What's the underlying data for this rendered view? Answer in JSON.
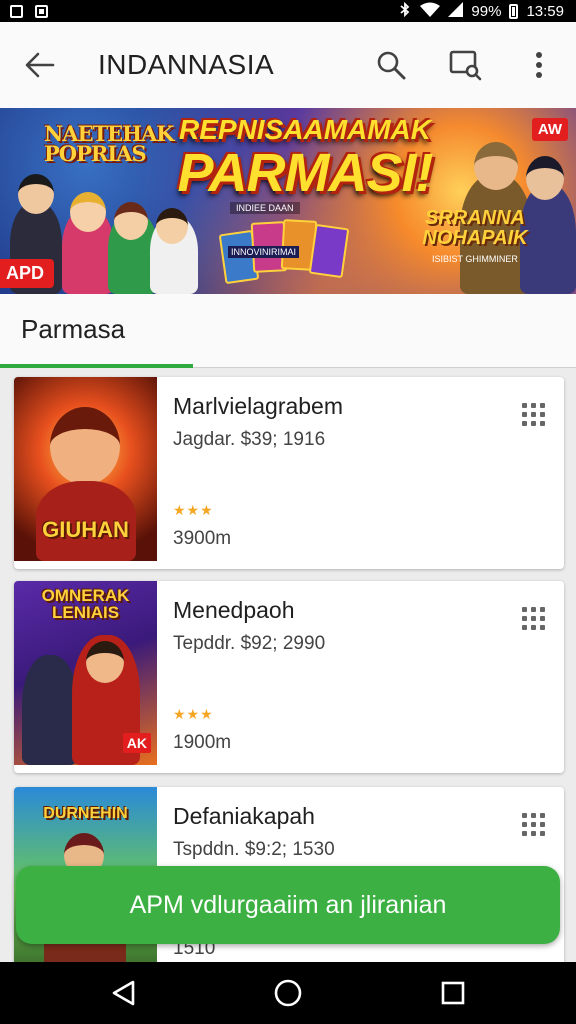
{
  "status_bar": {
    "battery_text": "99%",
    "time": "13:59",
    "icons": [
      "image-icon",
      "gallery-icon",
      "bluetooth-icon",
      "wifi-icon",
      "signal-icon",
      "battery-icon"
    ]
  },
  "app_bar": {
    "title": "INDANNASIA",
    "icons": [
      "back-arrow-icon",
      "search-icon",
      "cast-icon",
      "more-vert-icon"
    ]
  },
  "banner": {
    "top_left_text": "NAETEHAK POPRIAS",
    "title_line1": "REPNISAAMAMAK",
    "title_line2": "PARMASI!",
    "subtitle": "INDIEE DAAN",
    "badge_right": "AW",
    "badge_left": "APD",
    "card_label": "INNOVINIRIMAI",
    "right_text": "SRRANNA NOHAPAIK",
    "right_subtext": "ISIBIST GHIMMINER",
    "colors": {
      "badge": "#e21e1e",
      "title_yellow": "#ffe02e"
    }
  },
  "tab": {
    "label": "Parmasa",
    "indicator_color": "#2eaa40"
  },
  "items": [
    {
      "name": "Marlvielagrabem",
      "meta": "Jagdar. $39; 1916",
      "stars": "★★★",
      "size": "3900m",
      "thumb_title": "GIUHAN",
      "thumb_badge": ""
    },
    {
      "name": "Menedpaoh",
      "meta": "Tepddr. $92; 2990",
      "stars": "★★★",
      "size": "1900m",
      "thumb_title": "OMNERAK LENIAIS",
      "thumb_badge": "AK"
    },
    {
      "name": "Defaniakapah",
      "meta": "Tspddn. $9:2; 1530",
      "stars": "★★",
      "size": "1510",
      "thumb_title": "DURNEHIN",
      "thumb_badge": ""
    }
  ],
  "snackbar": {
    "text": "APM vdlurgaaiim an jliranian",
    "color": "#3cb043"
  },
  "nav_bar": {
    "icons": [
      "back-triangle-icon",
      "home-circle-icon",
      "recents-square-icon"
    ]
  }
}
